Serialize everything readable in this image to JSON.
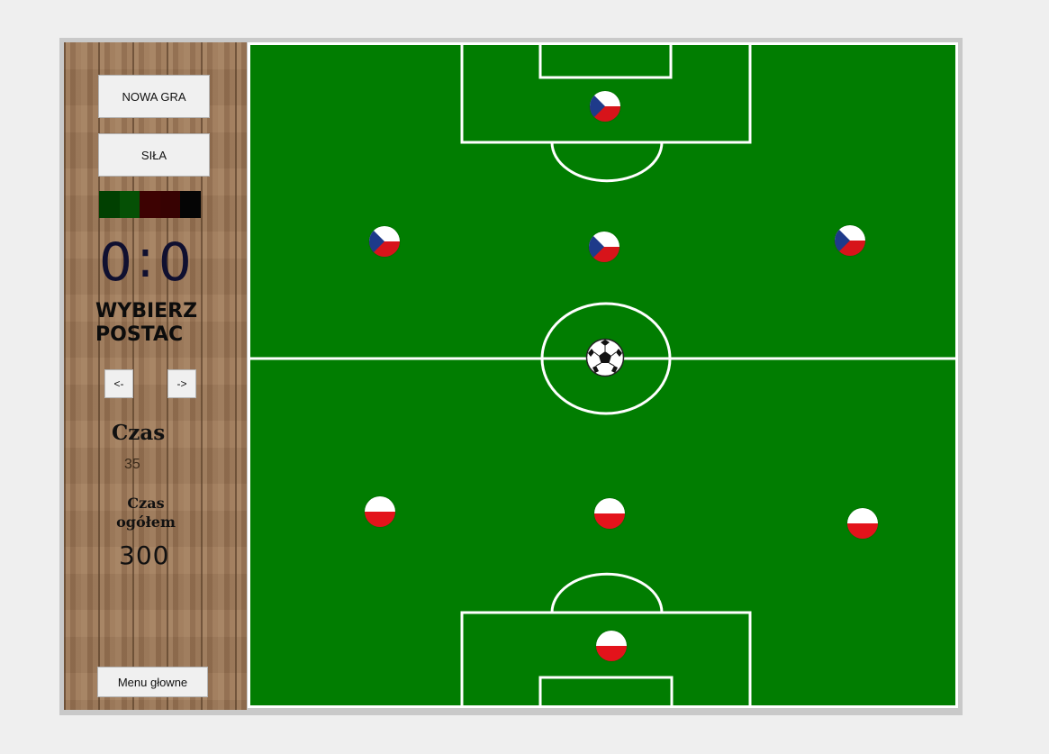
{
  "sidebar": {
    "new_game_label": "NOWA GRA",
    "power_label": "SIŁA",
    "power_segments": [
      "#014001",
      "#055005",
      "#3d0202",
      "#370202",
      "#050505"
    ],
    "score_home": "0",
    "score_separator": ":",
    "score_away": "0",
    "choose_label": "WYBIERZ POSTAC",
    "prev_label": "<-",
    "next_label": "->",
    "time_label": "Czas",
    "time_value": "35",
    "total_time_label": "Czas ogółem",
    "total_time_value": "300",
    "main_menu_label": "Menu głowne"
  },
  "pitch": {
    "color": "#017d01",
    "line_color": "#ffffff",
    "teams": {
      "top": {
        "flag": "czech",
        "players": 4
      },
      "bottom": {
        "flag": "poland",
        "players": 4
      }
    },
    "ball_icon": "soccer-ball-icon"
  },
  "colors": {
    "czech_blue": "#1e3a8a",
    "czech_red": "#d7141a",
    "poland_red": "#e3131b"
  }
}
